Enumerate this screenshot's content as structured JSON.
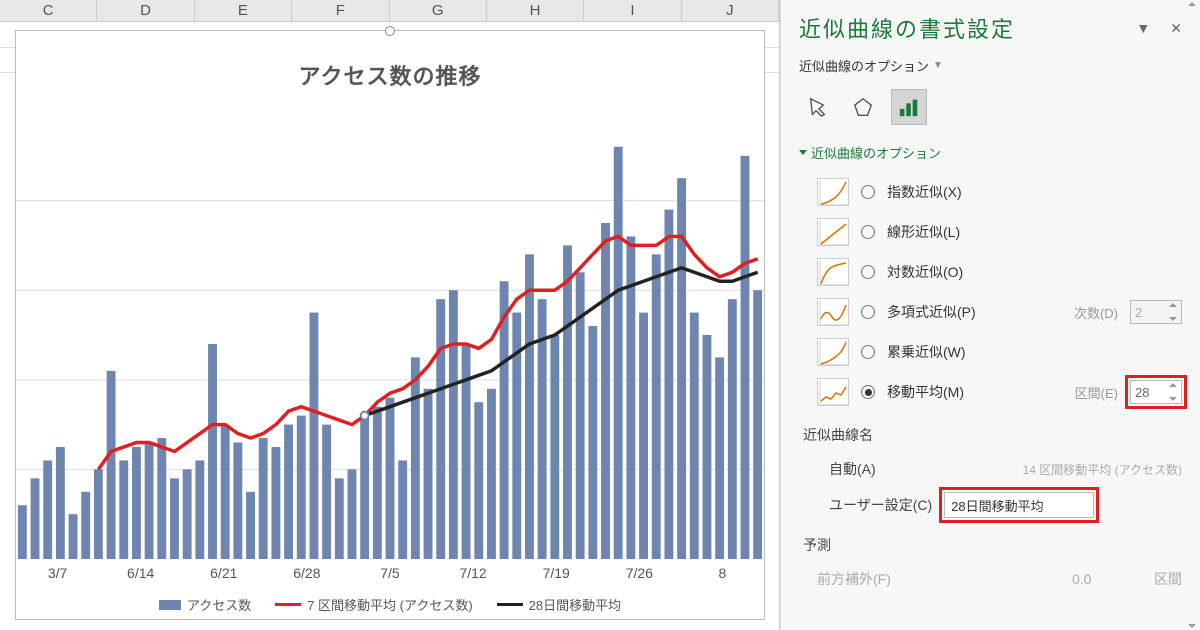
{
  "columns": [
    "C",
    "D",
    "E",
    "F",
    "G",
    "H",
    "I",
    "J"
  ],
  "chart": {
    "title": "アクセス数の推移",
    "x_ticks": [
      "3/7",
      "6/14",
      "6/21",
      "6/28",
      "7/5",
      "7/12",
      "7/19",
      "7/26",
      "8"
    ],
    "legend": {
      "bar": "アクセス数",
      "red": "7 区間移動平均 (アクセス数)",
      "black": "28日間移動平均"
    }
  },
  "chart_data": {
    "type": "bar",
    "title": "アクセス数の推移",
    "xlabel": "",
    "ylabel": "",
    "ylim": [
      0,
      100
    ],
    "series": [
      {
        "name": "アクセス数",
        "type": "bar",
        "values": [
          12,
          18,
          22,
          25,
          10,
          15,
          20,
          42,
          22,
          25,
          26,
          27,
          18,
          20,
          22,
          48,
          30,
          26,
          15,
          27,
          25,
          30,
          32,
          55,
          30,
          18,
          20,
          32,
          34,
          36,
          22,
          45,
          38,
          58,
          60,
          48,
          35,
          38,
          62,
          55,
          68,
          58,
          50,
          70,
          64,
          52,
          75,
          92,
          72,
          55,
          68,
          78,
          85,
          55,
          50,
          45,
          58,
          90,
          60
        ]
      },
      {
        "name": "7 区間移動平均 (アクセス数)",
        "type": "line",
        "values": [
          null,
          null,
          null,
          null,
          null,
          null,
          20,
          24,
          25,
          26,
          26,
          25,
          24,
          26,
          28,
          30,
          30,
          28,
          27,
          28,
          30,
          33,
          34,
          33,
          32,
          31,
          30,
          32,
          35,
          37,
          38,
          40,
          43,
          47,
          48,
          48,
          47,
          49,
          54,
          58,
          60,
          60,
          60,
          62,
          65,
          68,
          71,
          72,
          70,
          70,
          70,
          72,
          72,
          68,
          65,
          63,
          64,
          66,
          67
        ]
      },
      {
        "name": "28日間移動平均",
        "type": "line",
        "values": [
          null,
          null,
          null,
          null,
          null,
          null,
          null,
          null,
          null,
          null,
          null,
          null,
          null,
          null,
          null,
          null,
          null,
          null,
          null,
          null,
          null,
          null,
          null,
          null,
          null,
          null,
          null,
          32,
          33,
          34,
          35,
          36,
          37,
          38,
          39,
          40,
          41,
          42,
          44,
          46,
          48,
          49,
          50,
          52,
          54,
          56,
          58,
          60,
          61,
          62,
          63,
          64,
          65,
          64,
          63,
          62,
          62,
          63,
          64
        ]
      }
    ]
  },
  "panel": {
    "title": "近似曲線の書式設定",
    "subtitle": "近似曲線のオプション",
    "section": "近似曲線のオプション",
    "trendline_options": [
      {
        "key": "exp",
        "label": "指数近似(X)",
        "hotkey": "X",
        "checked": false
      },
      {
        "key": "lin",
        "label": "線形近似(L)",
        "hotkey": "L",
        "checked": false
      },
      {
        "key": "log",
        "label": "対数近似(O)",
        "hotkey": "O",
        "checked": false
      },
      {
        "key": "poly",
        "label": "多項式近似(P)",
        "hotkey": "P",
        "checked": false,
        "aux_label": "次数(D)",
        "aux_value": "2"
      },
      {
        "key": "pow",
        "label": "累乗近似(W)",
        "hotkey": "W",
        "checked": false
      },
      {
        "key": "ma",
        "label": "移動平均(M)",
        "hotkey": "M",
        "checked": true,
        "aux_label": "区間(E)",
        "aux_value": "28"
      }
    ],
    "name_section": {
      "header": "近似曲線名",
      "auto_label": "自動(A)",
      "auto_value_preview": "14 区間移動平均 (アクセス数)",
      "custom_label": "ユーザー設定(C)",
      "custom_value": "28日間移動平均",
      "selected": "custom"
    },
    "forecast": {
      "header": "予測",
      "forward_label": "前方補外(F)",
      "forward_value": "0.0",
      "unit": "区間"
    }
  }
}
